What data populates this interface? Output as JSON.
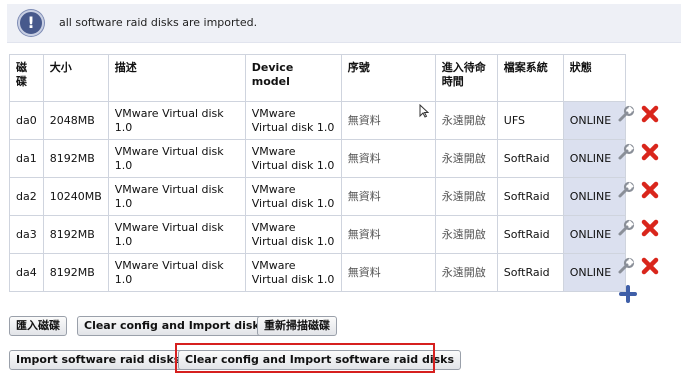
{
  "notice": {
    "icon": "exclamation-icon",
    "message": "all software raid disks are imported."
  },
  "table": {
    "headers": [
      "磁碟",
      "大小",
      "描述",
      "Device model",
      "序號",
      "進入待命時間",
      "檔案系統",
      "狀態"
    ],
    "rows": [
      {
        "disk": "da0",
        "size": "2048MB",
        "desc": "VMware Virtual disk 1.0",
        "model": "VMware Virtual disk 1.0",
        "serial": "無資料",
        "standby": "永遠開啟",
        "fs": "UFS",
        "state": "ONLINE"
      },
      {
        "disk": "da1",
        "size": "8192MB",
        "desc": "VMware Virtual disk 1.0",
        "model": "VMware Virtual disk 1.0",
        "serial": "無資料",
        "standby": "永遠開啟",
        "fs": "SoftRaid",
        "state": "ONLINE"
      },
      {
        "disk": "da2",
        "size": "10240MB",
        "desc": "VMware Virtual disk 1.0",
        "model": "VMware Virtual disk 1.0",
        "serial": "無資料",
        "standby": "永遠開啟",
        "fs": "SoftRaid",
        "state": "ONLINE"
      },
      {
        "disk": "da3",
        "size": "8192MB",
        "desc": "VMware Virtual disk 1.0",
        "model": "VMware Virtual disk 1.0",
        "serial": "無資料",
        "standby": "永遠開啟",
        "fs": "SoftRaid",
        "state": "ONLINE"
      },
      {
        "disk": "da4",
        "size": "8192MB",
        "desc": "VMware Virtual disk 1.0",
        "model": "VMware Virtual disk 1.0",
        "serial": "無資料",
        "standby": "永遠開啟",
        "fs": "SoftRaid",
        "state": "ONLINE"
      }
    ],
    "row_action_icons": [
      "wrench-icon",
      "delete-icon"
    ],
    "add_icon": "plus-icon"
  },
  "buttons": {
    "import_disks": "匯入磁碟",
    "clear_config_import": "Clear config and Import disks",
    "rescan_disks": "重新掃描磁碟",
    "import_software_raid": "Import software raid disks",
    "clear_config_import_software_raid": "Clear config and Import software raid disks"
  },
  "colors": {
    "accent": "#47598c",
    "state_cell": "#dbe0ef",
    "delete": "#d9261c",
    "add": "#3f5fa8",
    "highlight": "#d6201f"
  }
}
